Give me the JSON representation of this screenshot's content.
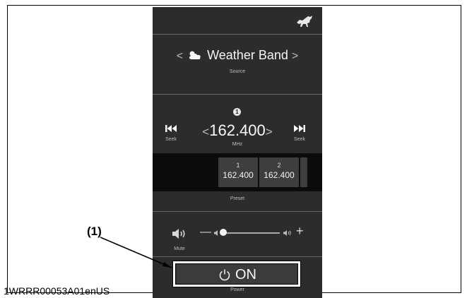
{
  "header": {
    "logo_icon": "mustang-horse-icon"
  },
  "source": {
    "prev_chevron": "<",
    "name": "Weather Band",
    "next_chevron": ">",
    "icon": "cloud-sun-icon",
    "caption": "Source"
  },
  "tuner": {
    "preset_indicator": "1",
    "prev_chevron": "<",
    "frequency": "162.400",
    "next_chevron": ">",
    "unit": "MHz",
    "seek_back_label": "Seek",
    "seek_forward_label": "Seek"
  },
  "presets": {
    "items": [
      {
        "number": "1",
        "frequency": "162.400"
      },
      {
        "number": "2",
        "frequency": "162.400"
      }
    ],
    "caption": "Preset"
  },
  "volume": {
    "mute_label": "Mute",
    "minus": "—",
    "plus": "+",
    "level": 0.0
  },
  "power": {
    "label": "ON",
    "caption": "Power"
  },
  "annotation": {
    "callout": "(1)",
    "document_code": "1WRRR00053A01enUS"
  },
  "colors": {
    "panel": "#2c2c2c",
    "preset_strip": "#0b0b0b",
    "button": "#3b3b3b",
    "text": "#f0f0f0"
  }
}
